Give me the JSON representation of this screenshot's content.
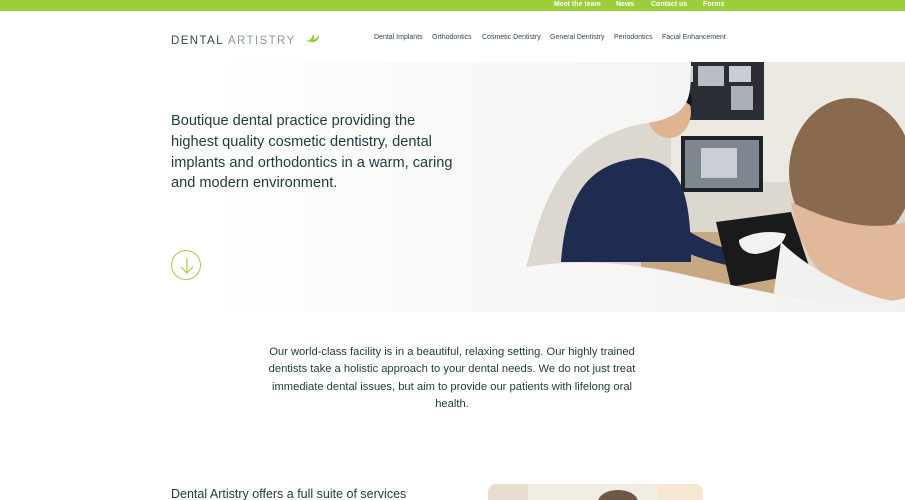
{
  "topbar": {
    "links": [
      "Meet the team",
      "News",
      "Contact us",
      "Forms"
    ],
    "accent_color": "#9ccd3a"
  },
  "logo": {
    "word1": "DENTAL",
    "word2": "ARTISTRY",
    "icon": "leaf-icon"
  },
  "nav": {
    "items": [
      "Dental Implants",
      "Orthodontics",
      "Cosmetic Dentistry",
      "General Dentistry",
      "Periodontics",
      "Facial Enhancement"
    ]
  },
  "hero": {
    "title": "Boutique dental practice providing the highest quality cosmetic dentistry, dental implants and orthodontics in a warm, caring and modern environment.",
    "scroll_icon": "arrow-down-icon"
  },
  "intro": {
    "text": "Our world-class facility is in a beautiful, relaxing setting. Our highly trained dentists take a holistic approach to your dental needs. We do not just treat immediate dental issues, but aim to provide our patients with lifelong oral health."
  },
  "services": {
    "title": "Dental Artistry offers a full suite of services"
  }
}
